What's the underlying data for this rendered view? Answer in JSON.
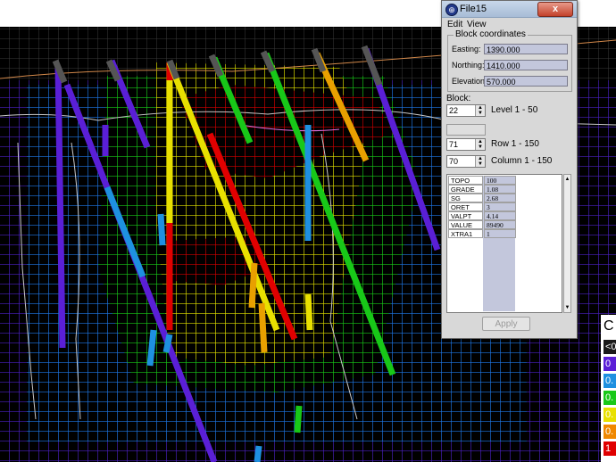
{
  "window": {
    "title": "File15",
    "close_label": "x",
    "menu": [
      "Edit",
      "View"
    ]
  },
  "block_coordinates": {
    "label": "Block coordinates",
    "easting_label": "Easting:",
    "easting_value": "1390.000",
    "northing_label": "Northing:",
    "northing_value": "1410.000",
    "elevation_label": "Elevation:",
    "elevation_value": "570.000"
  },
  "block": {
    "label": "Block:",
    "level_value": "22",
    "level_range": "Level 1 - 50",
    "row_value": "71",
    "row_range": "Row 1 - 150",
    "column_value": "70",
    "column_range": "Column 1 - 150"
  },
  "attributes": [
    {
      "name": "TOPO",
      "value": "100"
    },
    {
      "name": "GRADE",
      "value": "1.08"
    },
    {
      "name": "SG",
      "value": "2.68"
    },
    {
      "name": "ORET",
      "value": "3"
    },
    {
      "name": "VALPT",
      "value": "4.14"
    },
    {
      "name": "VALUE",
      "value": "89490"
    },
    {
      "name": "XTRA1",
      "value": "1"
    }
  ],
  "apply_label": "Apply",
  "legend": {
    "title": "C",
    "entries": [
      {
        "label": "<0",
        "color": "#1a1a1a"
      },
      {
        "label": "0",
        "color": "#5a1fd6"
      },
      {
        "label": "0.",
        "color": "#1e90e0"
      },
      {
        "label": "0.",
        "color": "#18c818"
      },
      {
        "label": "0.",
        "color": "#e8e000"
      },
      {
        "label": "0.",
        "color": "#f08800"
      },
      {
        "label": "1",
        "color": "#e00000"
      }
    ]
  },
  "colors": {
    "background": "#000000",
    "grid_blue": "#1e78e8",
    "grid_purple": "#4a20c0",
    "grid_green": "#18c818",
    "grid_yellow": "#e0e000",
    "grid_red": "#d00000",
    "drillhole_top": "#555555",
    "contour_line": "#c8c8c8"
  }
}
